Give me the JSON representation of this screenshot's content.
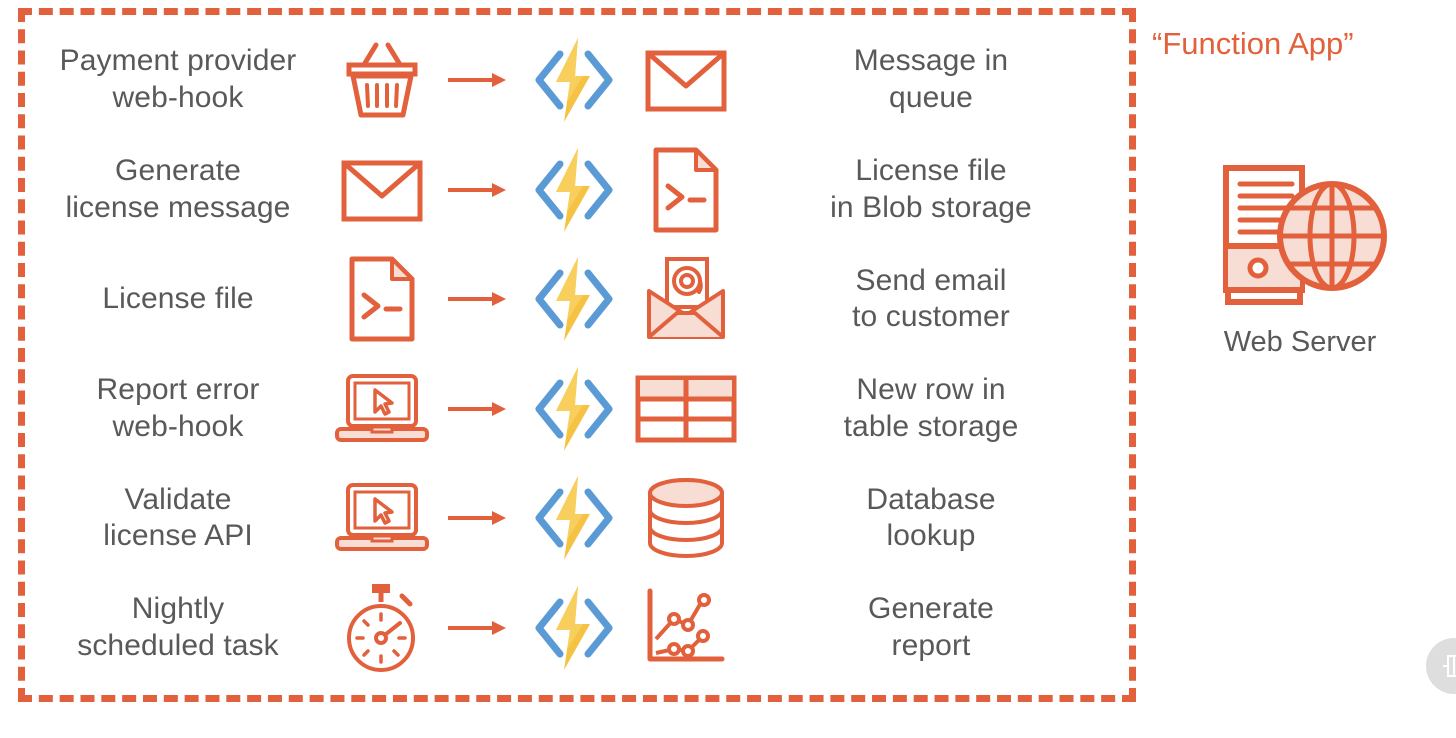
{
  "diagram": {
    "title": "“Function App”",
    "colors": {
      "orange": "#e2613c",
      "orange_fill": "#f7ddd3",
      "azure_blue": "#5b9bd5",
      "azure_yellow": "#f5c243",
      "text_grey": "#58595b",
      "badge_grey": "#dededf"
    },
    "boundary": {
      "name": "function-app-boundary",
      "style": "dashed",
      "color": "#e2613c"
    },
    "rows": [
      {
        "trigger_label": "Payment provider\nweb-hook",
        "trigger_icon": "shopping-basket-icon",
        "arrow_icon": "arrow-right-icon",
        "function_icon": "azure-functions-icon",
        "output_icon": "envelope-icon",
        "output_label": "Message in\nqueue"
      },
      {
        "trigger_label": "Generate\nlicense message",
        "trigger_icon": "envelope-icon",
        "arrow_icon": "arrow-right-icon",
        "function_icon": "azure-functions-icon",
        "output_icon": "license-file-icon",
        "output_label": "License file\nin Blob storage"
      },
      {
        "trigger_label": "License file",
        "trigger_icon": "license-file-icon",
        "arrow_icon": "arrow-right-icon",
        "function_icon": "azure-functions-icon",
        "output_icon": "email-at-icon",
        "output_label": "Send email\nto customer"
      },
      {
        "trigger_label": "Report error\nweb-hook",
        "trigger_icon": "laptop-cursor-icon",
        "arrow_icon": "arrow-right-icon",
        "function_icon": "azure-functions-icon",
        "output_icon": "table-storage-icon",
        "output_label": "New row in\ntable storage"
      },
      {
        "trigger_label": "Validate\nlicense API",
        "trigger_icon": "laptop-cursor-icon",
        "arrow_icon": "arrow-right-icon",
        "function_icon": "azure-functions-icon",
        "output_icon": "database-icon",
        "output_label": "Database\nlookup"
      },
      {
        "trigger_label": "Nightly\nscheduled task",
        "trigger_icon": "stopwatch-icon",
        "arrow_icon": "arrow-right-icon",
        "function_icon": "azure-functions-icon",
        "output_icon": "line-chart-icon",
        "output_label": "Generate\nreport"
      }
    ],
    "web_server": {
      "label": "Web Server",
      "icon": "web-server-globe-icon"
    },
    "corner_badge": {
      "icon": "presentation-badge-icon"
    }
  }
}
